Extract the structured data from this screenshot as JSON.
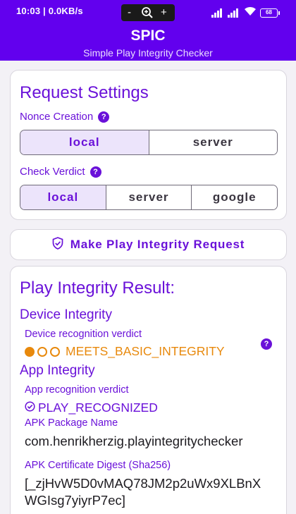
{
  "status_bar": {
    "time": "10:03 | 0.0KB/s",
    "zoom_minus": "-",
    "zoom_plus": "+",
    "battery": "68"
  },
  "app_bar": {
    "title": "SPIC",
    "subtitle": "Simple Play Integrity Checker"
  },
  "request_settings": {
    "heading": "Request Settings",
    "nonce_label": "Nonce Creation",
    "nonce_options": [
      "local",
      "server"
    ],
    "nonce_selected": "local",
    "verdict_label": "Check Verdict",
    "verdict_options": [
      "local",
      "server",
      "google"
    ],
    "verdict_selected": "local",
    "help_glyph": "?"
  },
  "request_button": {
    "label": "Make Play Integrity Request"
  },
  "result": {
    "heading": "Play Integrity Result:",
    "device_integrity": {
      "heading": "Device Integrity",
      "label": "Device recognition verdict",
      "verdict": "MEETS_BASIC_INTEGRITY",
      "level_filled": 1,
      "level_total": 3
    },
    "app_integrity": {
      "heading": "App Integrity",
      "label": "App recognition verdict",
      "verdict": "PLAY_RECOGNIZED",
      "package_label": "APK Package Name",
      "package_name": "com.henrikherzig.playintegritychecker",
      "digest_label": "APK Certificate Digest (Sha256)",
      "digest_line1": "[_zjHvW5D0vMAQ78JM2p2uWx9XLBnX",
      "digest_line2": "WGIsg7yiyrP7ec]"
    }
  },
  "colors": {
    "primary": "#6200ee",
    "accent_text": "#6a11d9",
    "warning": "#e8890c"
  }
}
